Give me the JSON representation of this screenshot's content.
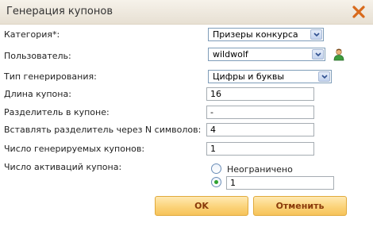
{
  "dialog": {
    "title": "Генерация купонов",
    "close_icon": "close-x-icon"
  },
  "form": {
    "category": {
      "label": "Категория*:",
      "value": "Призеры конкурса"
    },
    "user": {
      "label": "Пользователь:",
      "value": "wildwolf",
      "icon": "user-icon"
    },
    "gen_type": {
      "label": "Тип генерирования:",
      "value": "Цифры и буквы"
    },
    "length": {
      "label": "Длина купона:",
      "value": "16"
    },
    "separator": {
      "label": "Разделитель в купоне:",
      "value": "-"
    },
    "separator_n": {
      "label": "Вставлять разделитель через N символов:",
      "value": "4"
    },
    "count": {
      "label": "Число генерируемых купонов:",
      "value": "1"
    },
    "activations": {
      "label": "Число активаций купона:",
      "unlimited_label": "Неограничено",
      "value": "1",
      "selected": "custom"
    }
  },
  "buttons": {
    "ok": "OK",
    "cancel": "Отменить"
  },
  "colors": {
    "accent": "#f6c35a",
    "button_text": "#8a3a0a",
    "close": "#d86a1c"
  }
}
